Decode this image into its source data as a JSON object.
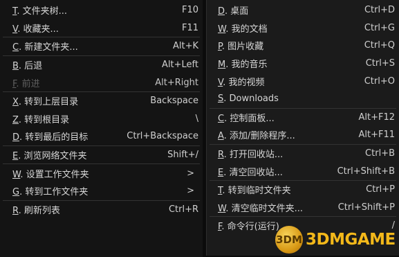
{
  "left_menu": {
    "items": [
      {
        "key": "T",
        "text": ". 文件夹树...",
        "shortcut": "F10"
      },
      {
        "key": "V",
        "text": ". 收藏夹...",
        "shortcut": "F11"
      },
      {
        "key": "C",
        "text": ". 新建文件夹...",
        "shortcut": "Alt+K"
      },
      {
        "key": "B",
        "text": ". 后退",
        "shortcut": "Alt+Left"
      },
      {
        "key": "F",
        "text": ". 前进",
        "shortcut": "Alt+Right"
      },
      {
        "key": "X",
        "text": ". 转到上层目录",
        "shortcut": "Backspace"
      },
      {
        "key": "Z",
        "text": ". 转到根目录",
        "shortcut": "\\"
      },
      {
        "key": "D",
        "text": ". 转到最后的目标",
        "shortcut": "Ctrl+Backspace"
      },
      {
        "key": "E",
        "text": ". 浏览网络文件夹",
        "shortcut": "Shift+/"
      },
      {
        "key": "W",
        "text": ". 设置工作文件夹",
        "shortcut": ">"
      },
      {
        "key": "G",
        "text": ". 转到工作文件夹",
        "shortcut": ">"
      },
      {
        "key": "R",
        "text": ". 刷新列表",
        "shortcut": "Ctrl+R"
      }
    ]
  },
  "right_menu": {
    "items": [
      {
        "key": "D",
        "text": ". 桌面",
        "shortcut": "Ctrl+D"
      },
      {
        "key": "W",
        "text": ". 我的文档",
        "shortcut": "Ctrl+G"
      },
      {
        "key": "P",
        "text": ". 图片收藏",
        "shortcut": "Ctrl+Q"
      },
      {
        "key": "M",
        "text": ". 我的音乐",
        "shortcut": "Ctrl+S"
      },
      {
        "key": "V",
        "text": ". 我的视频",
        "shortcut": "Ctrl+O"
      },
      {
        "key": "S",
        "text": ". Downloads",
        "shortcut": ""
      },
      {
        "key": "C",
        "text": ". 控制面板...",
        "shortcut": "Alt+F12"
      },
      {
        "key": "A",
        "text": ". 添加/删除程序...",
        "shortcut": "Alt+F11"
      },
      {
        "key": "R",
        "text": ". 打开回收站...",
        "shortcut": "Ctrl+B"
      },
      {
        "key": "E",
        "text": ". 清空回收站...",
        "shortcut": "Ctrl+Shift+B"
      },
      {
        "key": "T",
        "text": ". 转到临时文件夹",
        "shortcut": "Ctrl+P"
      },
      {
        "key": "W",
        "text": ". 清空临时文件夹...",
        "shortcut": "Ctrl+Shift+P"
      },
      {
        "key": "F",
        "text": ". 命令行(运行)",
        "shortcut": "/"
      }
    ]
  },
  "watermark": {
    "logo_text": "3DM",
    "brand": "3DMGAME"
  }
}
